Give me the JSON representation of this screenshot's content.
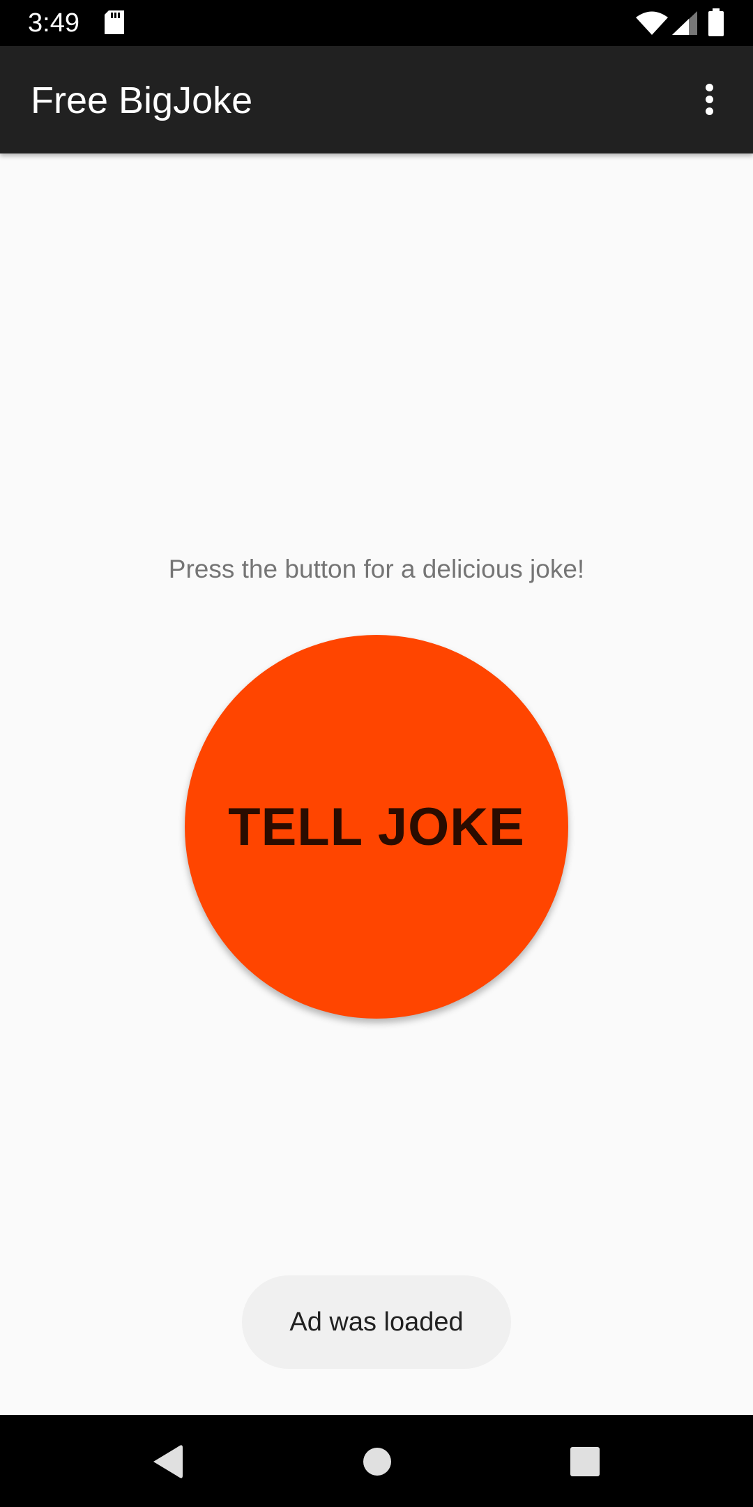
{
  "status_bar": {
    "time": "3:49",
    "icons": [
      "sd-card-icon",
      "wifi-icon",
      "signal-icon",
      "battery-icon"
    ]
  },
  "app_bar": {
    "title": "Free BigJoke",
    "menu_icon": "more-vert-icon"
  },
  "main": {
    "prompt": "Press the button for a delicious joke!",
    "button_label": "TELL JOKE"
  },
  "toast": {
    "message": "Ad was loaded"
  },
  "nav_bar": {
    "icons": [
      "back-icon",
      "home-icon",
      "recents-icon"
    ]
  },
  "colors": {
    "status_bar": "#000000",
    "app_bar": "#212121",
    "background": "#fafafa",
    "button": "#ff4500",
    "button_text": "#2a0c00",
    "prompt_text": "#757575",
    "toast_bg": "#f0f0f0"
  }
}
